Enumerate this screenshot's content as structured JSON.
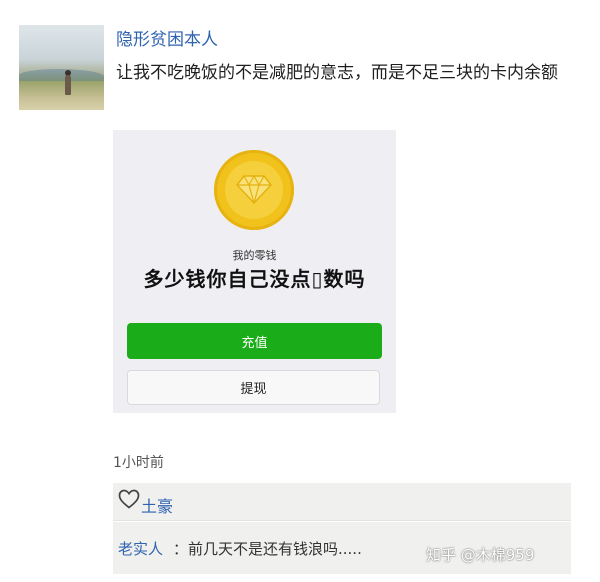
{
  "post": {
    "author": "隐形贫困本人",
    "text": "让我不吃晚饭的不是减肥的意志，而是不足三块的卡内余额"
  },
  "wallet": {
    "label": "我的零钱",
    "amount_text": "多少钱你自己没点▯数吗",
    "recharge_label": "充值",
    "withdraw_label": "提现"
  },
  "meta": {
    "time": "1小时前"
  },
  "likes": {
    "icon": "heart-outline",
    "names": "土豪"
  },
  "comments": [
    {
      "author": "老实人",
      "text": "：前几天不是还有钱浪吗....."
    }
  ],
  "watermark": "知乎 @木棉959",
  "colors": {
    "link": "#2f63b0",
    "wechat_green": "#1aad19",
    "coin_gold": "#f1c21b"
  }
}
